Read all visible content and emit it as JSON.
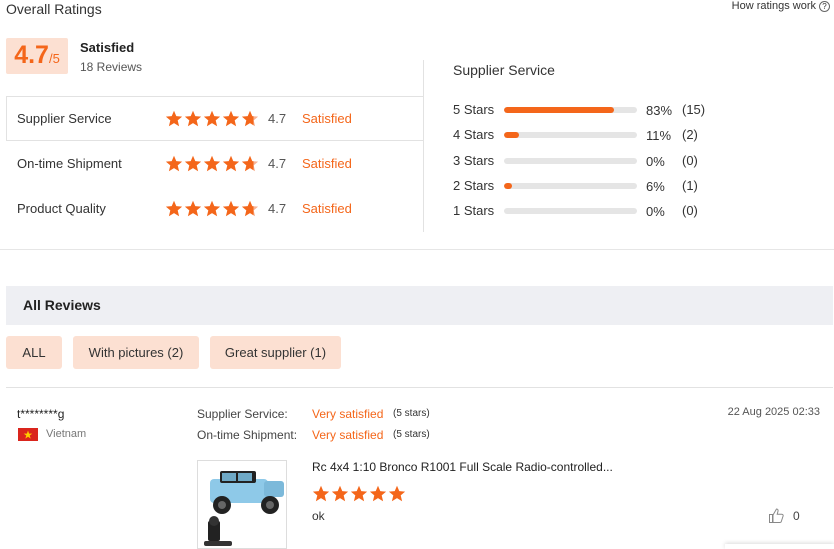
{
  "header": {
    "title": "Overall Ratings",
    "how_ratings_work": "How ratings work",
    "help_icon": "question-circle-icon"
  },
  "summary": {
    "score": "4.7",
    "out_of": "/5",
    "label": "Satisfied",
    "reviews": "18 Reviews"
  },
  "categories": [
    {
      "label": "Supplier Service",
      "score": "4.7",
      "rating_label": "Satisfied",
      "stars": 4.7
    },
    {
      "label": "On-time Shipment",
      "score": "4.7",
      "rating_label": "Satisfied",
      "stars": 4.7
    },
    {
      "label": "Product Quality",
      "score": "4.7",
      "rating_label": "Satisfied",
      "stars": 4.7
    }
  ],
  "distribution": {
    "title": "Supplier Service",
    "rows": [
      {
        "label": "5 Stars",
        "percent": "83%",
        "count": "(15)",
        "fraction": 0.83
      },
      {
        "label": "4 Stars",
        "percent": "11%",
        "count": "(2)",
        "fraction": 0.11
      },
      {
        "label": "3 Stars",
        "percent": "0%",
        "count": "(0)",
        "fraction": 0
      },
      {
        "label": "2 Stars",
        "percent": "6%",
        "count": "(1)",
        "fraction": 0.06
      },
      {
        "label": "1 Stars",
        "percent": "0%",
        "count": "(0)",
        "fraction": 0
      }
    ]
  },
  "reviews_section": {
    "title": "All Reviews",
    "filters": [
      {
        "label": "ALL"
      },
      {
        "label": "With pictures (2)"
      },
      {
        "label": "Great supplier (1)"
      }
    ]
  },
  "review": {
    "user": "t********g",
    "country": "Vietnam",
    "supplier_service_label": "Supplier Service:",
    "supplier_service_value": "Very satisfied",
    "supplier_service_stars": "(5 stars)",
    "shipment_label": "On-time Shipment:",
    "shipment_value": "Very satisfied",
    "shipment_stars": "(5 stars)",
    "date": "22 Aug 2025 02:33",
    "product_title": "Rc 4x4 1:10 Bronco R1001 Full Scale Radio-controlled...",
    "product_stars": 5,
    "comment": "ok",
    "likes": "0",
    "like_icon": "thumbs-up-icon",
    "flag_icon": "vietnam-flag-icon"
  },
  "colors": {
    "accent": "#f4661a",
    "filter_bg": "#fce0d2",
    "section_bg": "#eeeff3"
  }
}
